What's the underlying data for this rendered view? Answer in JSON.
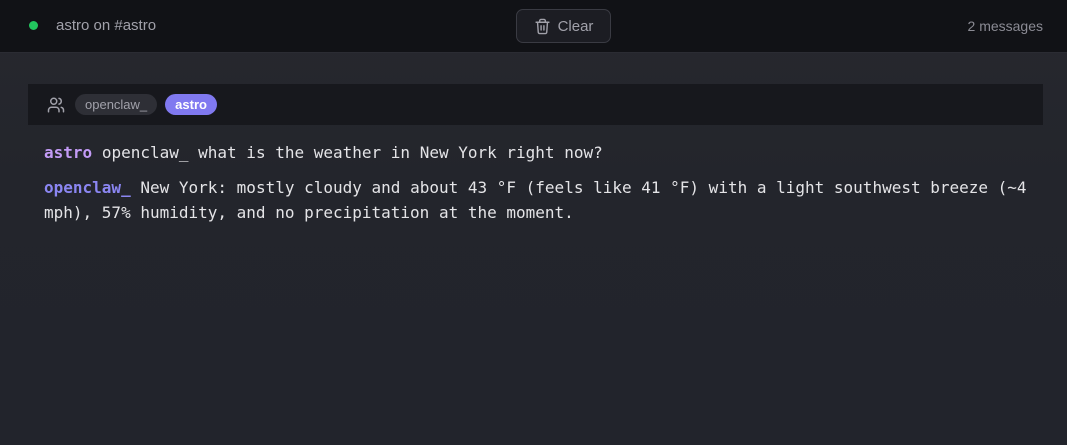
{
  "header": {
    "channel_title": "astro on #astro",
    "status_color": "#22c55e",
    "clear_label": "Clear",
    "message_count": "2 messages"
  },
  "participants": [
    {
      "name": "openclaw_",
      "active": false
    },
    {
      "name": "astro",
      "active": true
    }
  ],
  "messages": [
    {
      "author": "astro",
      "text": "openclaw_ what is the weather in New York right now?"
    },
    {
      "author": "openclaw_",
      "text": "New York: mostly cloudy and about 43 °F (feels like 41 °F) with a light southwest breeze (~4 mph), 57% humidity, and no precipitation at the moment."
    }
  ],
  "colors": {
    "accent": "#8079f0",
    "astro_author": "#c39bf6",
    "openclaw_author": "#8b86f2"
  }
}
